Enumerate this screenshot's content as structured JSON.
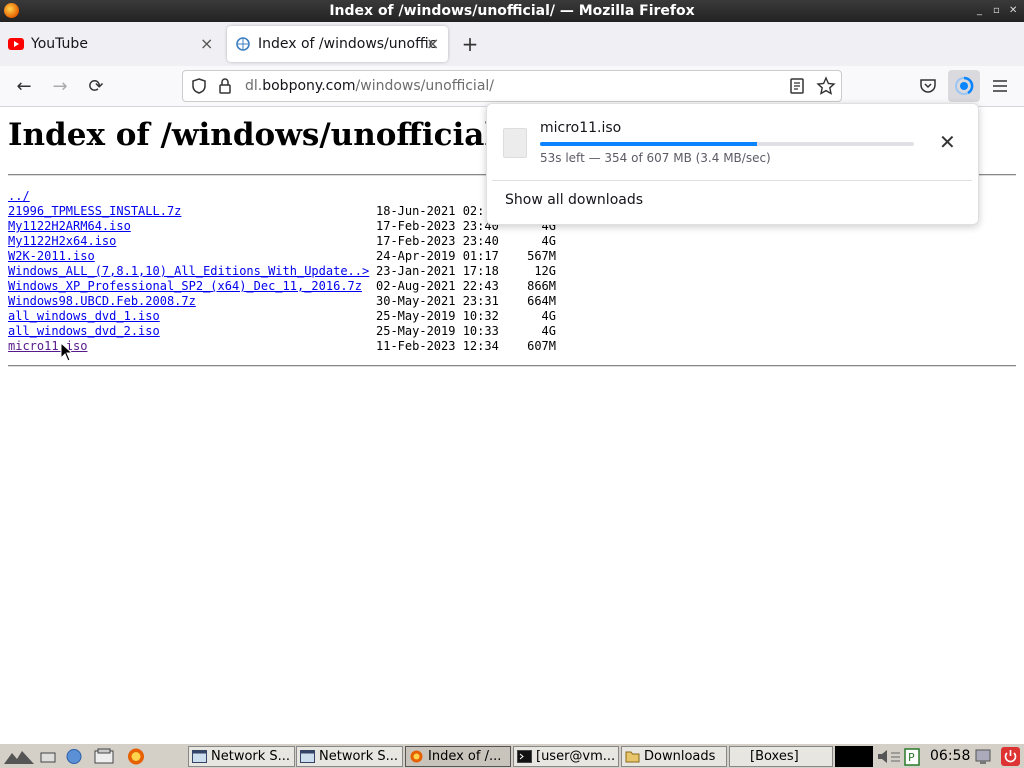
{
  "window": {
    "title": "Index of /windows/unofficial/ — Mozilla Firefox",
    "controls": [
      "_",
      "▫",
      "✕"
    ]
  },
  "tabs": [
    {
      "label": "YouTube",
      "icon": "youtube-icon"
    },
    {
      "label": "Index of /windows/unoffic",
      "icon": "page-icon"
    }
  ],
  "toolbar": {
    "back": "←",
    "forward": "→",
    "reload": "⟳",
    "new_tab": "+"
  },
  "url": {
    "host_prefix": "dl.",
    "host": "bobpony.com",
    "path": "/windows/unofficial/"
  },
  "page": {
    "heading": "Index of /windows/unofficial/",
    "parent_link": "../",
    "entries": [
      {
        "name": "21996_TPMLESS_INSTALL.7z",
        "date": "18-Jun-2021 02:",
        "size": ""
      },
      {
        "name": "My1122H2ARM64.iso",
        "date": "17-Feb-2023 23:40",
        "size": "4G"
      },
      {
        "name": "My1122H2x64.iso",
        "date": "17-Feb-2023 23:40",
        "size": "4G"
      },
      {
        "name": "W2K-2011.iso",
        "date": "24-Apr-2019 01:17",
        "size": "567M"
      },
      {
        "name": "Windows_ALL_(7,8.1,10)_All_Editions_With_Update..>",
        "date": "23-Jan-2021 17:18",
        "size": "12G"
      },
      {
        "name": "Windows_XP_Professional_SP2_(x64)_Dec_11,_2016.7z",
        "date": "02-Aug-2021 22:43",
        "size": "866M"
      },
      {
        "name": "Windows98.UBCD.Feb.2008.7z",
        "date": "30-May-2021 23:31",
        "size": "664M"
      },
      {
        "name": "all_windows_dvd_1.iso",
        "date": "25-May-2019 10:32",
        "size": "4G"
      },
      {
        "name": "all_windows_dvd_2.iso",
        "date": "25-May-2019 10:33",
        "size": "4G"
      },
      {
        "name": "micro11.iso",
        "date": "11-Feb-2023 12:34",
        "size": "607M"
      }
    ]
  },
  "downloads_panel": {
    "file_name": "micro11.iso",
    "status": "53s left — 354 of 607 MB (3.4 MB/sec)",
    "progress": 0.58,
    "show_all": "Show all downloads",
    "close": "✕"
  },
  "taskbar": {
    "items": [
      {
        "label": "Network S...",
        "active": false
      },
      {
        "label": "Network S...",
        "active": false
      },
      {
        "label": "Index of /...",
        "active": true
      },
      {
        "label": "[user@vm...",
        "active": false
      },
      {
        "label": "Downloads",
        "active": false
      },
      {
        "label": "[Boxes]",
        "active": false
      }
    ],
    "clock": "06:58"
  },
  "colors": {
    "accent": "#0a84ff",
    "link": "#0000ee",
    "visited": "#551a8b"
  }
}
